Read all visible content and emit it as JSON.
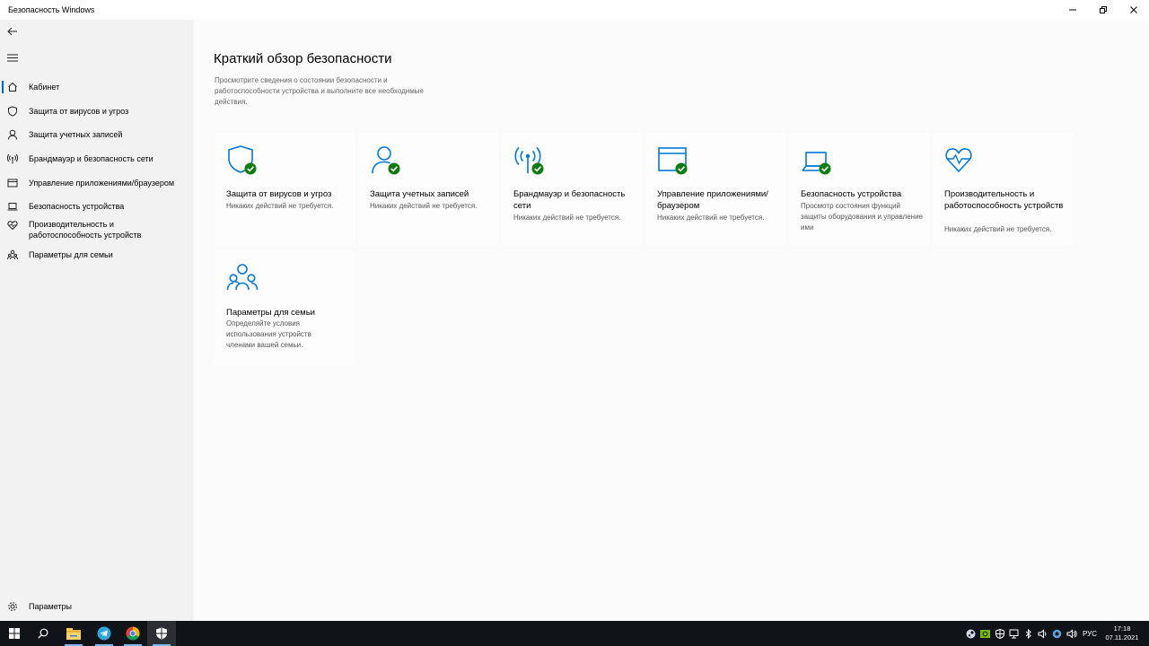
{
  "window": {
    "title": "Безопасность Windows"
  },
  "sidebar": {
    "items": [
      {
        "label": "Кабинет",
        "icon": "home-icon"
      },
      {
        "label": "Защита от вирусов и угроз",
        "icon": "shield-icon"
      },
      {
        "label": "Защита учетных записей",
        "icon": "person-icon"
      },
      {
        "label": "Брандмауэр и безопасность сети",
        "icon": "antenna-icon"
      },
      {
        "label": "Управление приложениями/браузером",
        "icon": "browser-window-icon"
      },
      {
        "label": "Безопасность устройства",
        "icon": "laptop-icon"
      },
      {
        "label": "Производительность и работоспособность устройств",
        "icon": "heart-icon"
      },
      {
        "label": "Параметры для семьи",
        "icon": "family-icon"
      }
    ],
    "settings_label": "Параметры"
  },
  "main": {
    "title": "Краткий обзор безопасности",
    "description": "Просмотрите сведения о состоянии безопасности и работоспособности устройства и выполните все необходимые действия.",
    "tiles": [
      {
        "title": "Защита от вирусов и угроз",
        "status": "Никаких действий не требуется.",
        "icon": "shield-icon",
        "ok": true
      },
      {
        "title": "Защита учетных записей",
        "status": "Никаких действий не требуется.",
        "icon": "person-icon",
        "ok": true
      },
      {
        "title": "Брандмауэр и безопасность сети",
        "status": "Никаких действий не требуется.",
        "icon": "antenna-icon",
        "ok": true
      },
      {
        "title": "Управление приложениями/браузером",
        "status": "Никаких действий не требуется.",
        "icon": "browser-window-icon",
        "ok": true
      },
      {
        "title": "Безопасность устройства",
        "status": "Просмотр состояния функций защиты оборудования и управление ими",
        "icon": "laptop-icon",
        "ok": true
      },
      {
        "title": "Производительность и работоспособность устройств",
        "status": "Никаких действий не требуется.",
        "icon": "heart-icon",
        "ok": false
      },
      {
        "title": "Параметры для семьи",
        "status": "Определяйте условия использования устройств членами вашей семьи.",
        "icon": "family-icon",
        "ok": false
      }
    ]
  },
  "taskbar": {
    "apps": [
      "windows-start-icon",
      "search-icon",
      "file-explorer-icon",
      "telegram-icon",
      "chrome-icon",
      "windows-security-icon"
    ],
    "language": "РУС",
    "time": "17:18",
    "date": "07.11.2021"
  },
  "colors": {
    "accent": "#0067c0",
    "icon_blue": "#0078d4",
    "ok_green": "#107c10"
  }
}
